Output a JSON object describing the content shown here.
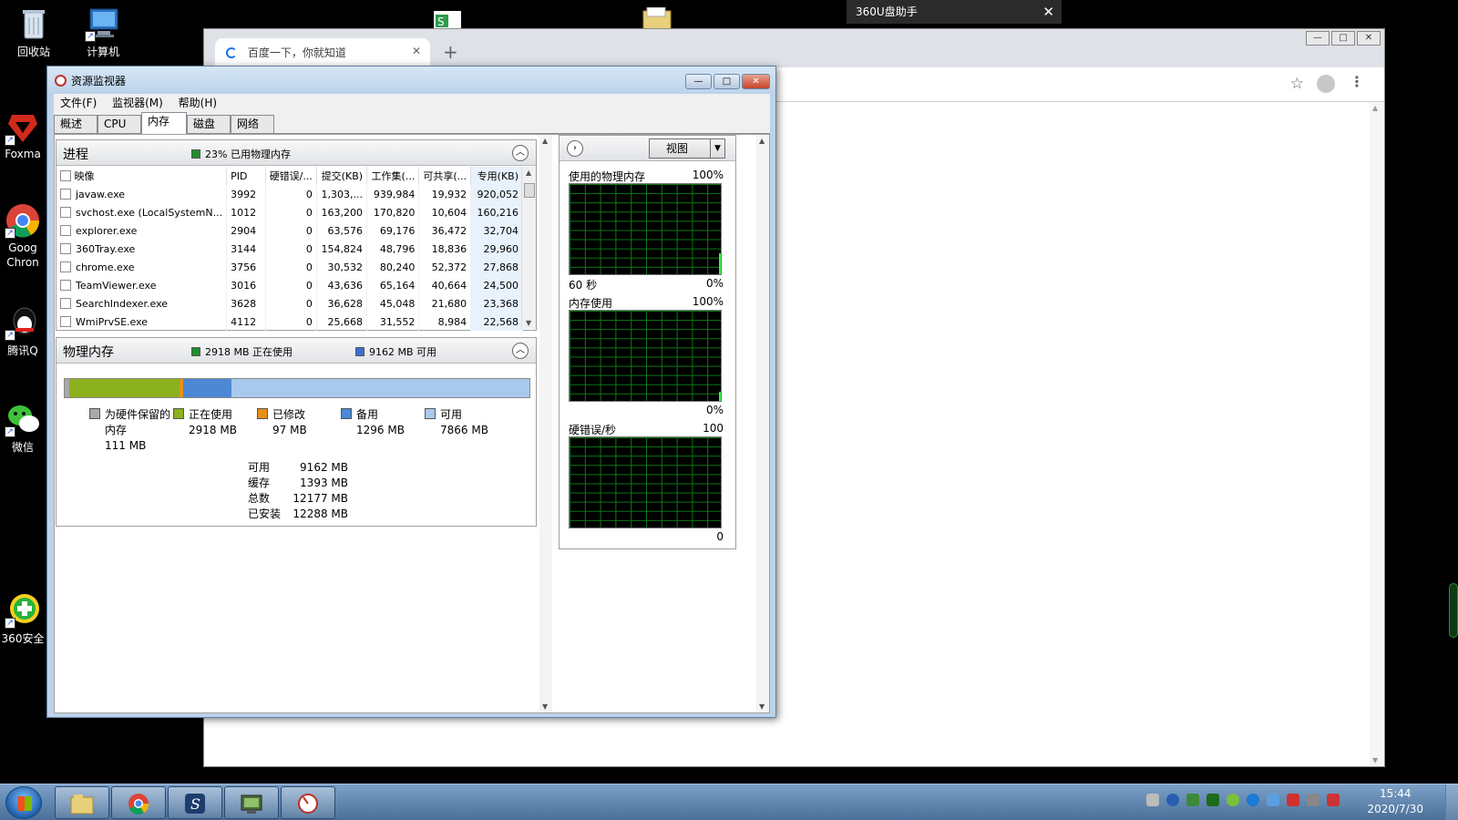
{
  "desktop": {
    "icons": [
      {
        "label": "回收站"
      },
      {
        "label": "计算机"
      },
      {
        "label": "Foxma"
      },
      {
        "label": "Goog Chron"
      },
      {
        "label": "腾讯Q"
      },
      {
        "label": "微信"
      },
      {
        "label": "360安全"
      }
    ]
  },
  "u_helper": {
    "title": "360U盘助手",
    "close": "✕"
  },
  "chrome": {
    "tab_title": "百度一下，你就知道",
    "tab_close": "✕",
    "new_tab": "+",
    "star": "☆",
    "menu": "⋮",
    "min": "—",
    "max": "□",
    "close": "✕"
  },
  "resmon": {
    "title": "资源监视器",
    "min": "—",
    "max": "□",
    "close": "✕",
    "menu": [
      "文件(F)",
      "监视器(M)",
      "帮助(H)"
    ],
    "tabs": [
      "概述",
      "CPU",
      "内存",
      "磁盘",
      "网络"
    ],
    "active_tab": "内存",
    "processes": {
      "title": "进程",
      "stat": "23% 已用物理内存",
      "stat_color": "#1f8f2a",
      "columns": [
        "映像",
        "PID",
        "硬错误/...",
        "提交(KB)",
        "工作集(...",
        "可共享(...",
        "专用(KB)"
      ],
      "rows": [
        [
          "javaw.exe",
          "3992",
          "0",
          "1,303,...",
          "939,984",
          "19,932",
          "920,052"
        ],
        [
          "svchost.exe (LocalSystemN...",
          "1012",
          "0",
          "163,200",
          "170,820",
          "10,604",
          "160,216"
        ],
        [
          "explorer.exe",
          "2904",
          "0",
          "63,576",
          "69,176",
          "36,472",
          "32,704"
        ],
        [
          "360Tray.exe",
          "3144",
          "0",
          "154,824",
          "48,796",
          "18,836",
          "29,960"
        ],
        [
          "chrome.exe",
          "3756",
          "0",
          "30,532",
          "80,240",
          "52,372",
          "27,868"
        ],
        [
          "TeamViewer.exe",
          "3016",
          "0",
          "43,636",
          "65,164",
          "40,664",
          "24,500"
        ],
        [
          "SearchIndexer.exe",
          "3628",
          "0",
          "36,628",
          "45,048",
          "21,680",
          "23,368"
        ],
        [
          "WmiPrvSE.exe",
          "4112",
          "0",
          "25,668",
          "31,552",
          "8,984",
          "22,568"
        ]
      ]
    },
    "physical": {
      "title": "物理内存",
      "in_use_stat": "2918 MB 正在使用",
      "available_stat": "9162 MB 可用",
      "bar": [
        {
          "name": "reserved",
          "mb": 111,
          "color": "#a8a8a8"
        },
        {
          "name": "in_use",
          "mb": 2918,
          "color": "#8bb11e"
        },
        {
          "name": "modified",
          "mb": 97,
          "color": "#e8901a"
        },
        {
          "name": "standby",
          "mb": 1296,
          "color": "#4c88d4"
        },
        {
          "name": "free",
          "mb": 7866,
          "color": "#a9c9ec"
        }
      ],
      "legend": [
        {
          "label": "为硬件保留的",
          "label2": "内存",
          "value": "111 MB",
          "color": "#a8a8a8"
        },
        {
          "label": "正在使用",
          "value": "2918 MB",
          "color": "#8bb11e"
        },
        {
          "label": "已修改",
          "value": "97 MB",
          "color": "#e8901a"
        },
        {
          "label": "备用",
          "value": "1296 MB",
          "color": "#4c88d4"
        },
        {
          "label": "可用",
          "value": "7866 MB",
          "color": "#a9c9ec"
        }
      ],
      "summary": [
        {
          "k": "可用",
          "v": "9162 MB"
        },
        {
          "k": "缓存",
          "v": "1393 MB"
        },
        {
          "k": "总数",
          "v": "12177 MB"
        },
        {
          "k": "已安装",
          "v": "12288 MB"
        }
      ]
    },
    "graphs": {
      "view_label": "视图",
      "items": [
        {
          "title": "使用的物理内存",
          "max": "100%",
          "left_bottom": "60 秒",
          "right_bottom": "0%",
          "level": 0.23
        },
        {
          "title": "内存使用",
          "max": "100%",
          "left_bottom": "",
          "right_bottom": "0%",
          "level": 0.1
        },
        {
          "title": "硬错误/秒",
          "max": "100",
          "left_bottom": "",
          "right_bottom": "0",
          "level": 0
        }
      ]
    }
  },
  "taskbar": {
    "time": "15:44",
    "date": "2020/7/30"
  }
}
